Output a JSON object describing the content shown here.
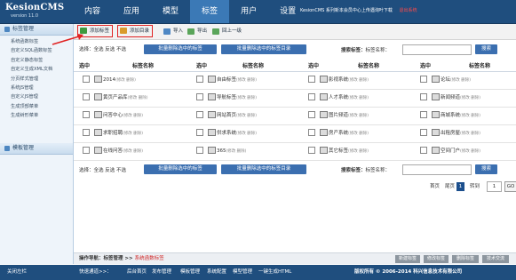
{
  "brand": {
    "name": "KesionCMS",
    "version": "version 11.0"
  },
  "nav": {
    "tabs": [
      "内容",
      "应用",
      "模型",
      "标签",
      "用户",
      "设置"
    ],
    "active_index": 3
  },
  "top_message": {
    "text": "KesionCMS 系列新本会员中心上传遇询叶下载",
    "exit_label": "退出系统"
  },
  "sidebar": {
    "section1": "标签管理",
    "items": [
      "系统函数标签",
      "自定义SQL函数标签",
      "自定义静态标签",
      "自定义生成XML文档",
      "分页样式管理",
      "系统JS管理",
      "自定义JS管理",
      "生成顶部菜单",
      "生成树形菜单"
    ],
    "section2": "模板管理"
  },
  "toolbar": {
    "add_tag": "添加标签",
    "add_dir": "添加目录",
    "import": "导入",
    "export": "导出",
    "back": "回上一级"
  },
  "select_bar": {
    "label": "选择：全选 反选 不选",
    "batch_delete": "批量删除选中的标签",
    "batch_delete_dir": "批量删除选中的标签目录",
    "search_label": "搜索标签：",
    "tag_name_label": "标签名称：",
    "search_btn": "搜索"
  },
  "table": {
    "col_select": "选中",
    "col_name": "标签名称",
    "rows": [
      [
        "2014",
        "自由标签",
        "影视系统",
        "论坛"
      ],
      [
        "黄页产品库",
        "导航标签",
        "人才系统",
        "新闻频道"
      ],
      [
        "问答中心",
        "网站首页",
        "图片频道",
        "商城系统"
      ],
      [
        "求职招聘",
        "供求系统",
        "房产系统",
        "出租房屋"
      ],
      [
        "在线问答",
        "365",
        "其它标签",
        "空间门户"
      ]
    ],
    "meta_text": "(修改 删除)"
  },
  "pager": {
    "first": "首页",
    "last": "尾页",
    "current": "1",
    "goto_label": "转到",
    "goto_value": "1",
    "go": "GO"
  },
  "op_bar": {
    "path_label": "操作导航：标签管理 >> ",
    "current": "系统函数标签",
    "buttons": [
      "新建标签",
      "修改标签",
      "删除标签",
      "技术交流"
    ]
  },
  "footer": {
    "close_left": "关闭左栏",
    "quick_label": "快速通道>>：",
    "links": [
      "后台首页",
      "发布管理",
      "模板管理",
      "系统配置",
      "模型管理",
      "一键生成HTML"
    ],
    "copyright": "版权所有 © 2006-2014 科兴信息技术有限公司"
  },
  "colors": {
    "nav_bg": "#1f4e7e",
    "nav_active": "#3b79b6",
    "blue_button": "#3b6fb0",
    "highlight": "#e02222"
  }
}
